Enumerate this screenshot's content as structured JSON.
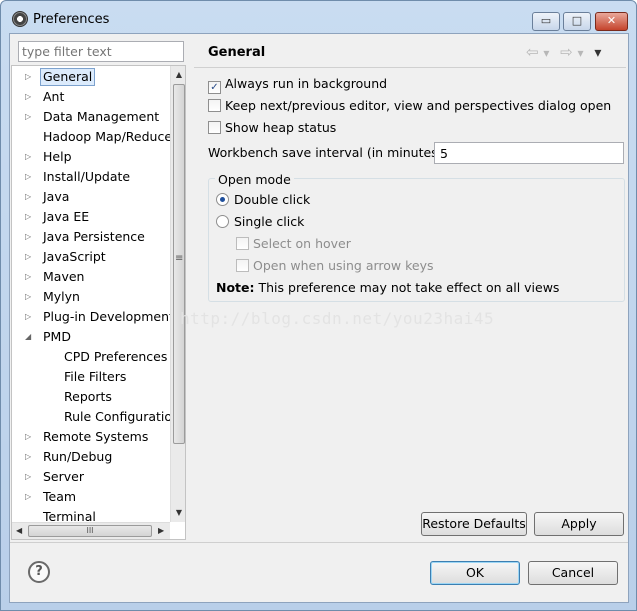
{
  "window": {
    "title": "Preferences",
    "min_glyph": "▭",
    "max_glyph": "□",
    "close_glyph": "✕"
  },
  "filter": {
    "placeholder": "type filter text"
  },
  "tree": {
    "items": [
      {
        "label": "General",
        "level": 0,
        "expander": "collapsed",
        "selected": true
      },
      {
        "label": "Ant",
        "level": 0,
        "expander": "collapsed"
      },
      {
        "label": "Data Management",
        "level": 0,
        "expander": "collapsed"
      },
      {
        "label": "Hadoop Map/Reduce",
        "level": 0,
        "expander": "none"
      },
      {
        "label": "Help",
        "level": 0,
        "expander": "collapsed"
      },
      {
        "label": "Install/Update",
        "level": 0,
        "expander": "collapsed"
      },
      {
        "label": "Java",
        "level": 0,
        "expander": "collapsed"
      },
      {
        "label": "Java EE",
        "level": 0,
        "expander": "collapsed"
      },
      {
        "label": "Java Persistence",
        "level": 0,
        "expander": "collapsed"
      },
      {
        "label": "JavaScript",
        "level": 0,
        "expander": "collapsed"
      },
      {
        "label": "Maven",
        "level": 0,
        "expander": "collapsed"
      },
      {
        "label": "Mylyn",
        "level": 0,
        "expander": "collapsed"
      },
      {
        "label": "Plug-in Development",
        "level": 0,
        "expander": "collapsed"
      },
      {
        "label": "PMD",
        "level": 0,
        "expander": "expanded"
      },
      {
        "label": "CPD Preferences",
        "level": 1,
        "expander": "none"
      },
      {
        "label": "File Filters",
        "level": 1,
        "expander": "none"
      },
      {
        "label": "Reports",
        "level": 1,
        "expander": "none"
      },
      {
        "label": "Rule Configuration",
        "level": 1,
        "expander": "none"
      },
      {
        "label": "Remote Systems",
        "level": 0,
        "expander": "collapsed"
      },
      {
        "label": "Run/Debug",
        "level": 0,
        "expander": "collapsed"
      },
      {
        "label": "Server",
        "level": 0,
        "expander": "collapsed"
      },
      {
        "label": "Team",
        "level": 0,
        "expander": "collapsed"
      },
      {
        "label": "Terminal",
        "level": 0,
        "expander": "none"
      }
    ],
    "scroll_up": "▲",
    "scroll_down": "▼",
    "scroll_left": "◀",
    "scroll_right": "▶",
    "vthumb_grip": "≡",
    "hthumb_grip": "III"
  },
  "general": {
    "title": "General",
    "nav_back": "⇦",
    "nav_back_menu": "▾",
    "nav_forward": "⇨",
    "nav_forward_menu": "▾",
    "view_menu": "▾",
    "always_run_bg": {
      "label": "Always run in background",
      "checked": true
    },
    "keep_dialog_open": {
      "label": "Keep next/previous editor, view and perspectives dialog open",
      "checked": false
    },
    "show_heap": {
      "label": "Show heap status",
      "checked": false
    },
    "interval": {
      "label": "Workbench save interval (in minutes):",
      "value": "5"
    },
    "open_mode": {
      "title": "Open mode",
      "double_click": {
        "label": "Double click",
        "selected": true
      },
      "single_click": {
        "label": "Single click",
        "selected": false
      },
      "select_on_hover": {
        "label": "Select on hover",
        "checked": false
      },
      "open_arrow_keys": {
        "label": "Open when using arrow keys",
        "checked": false
      },
      "note_bold": "Note:",
      "note_text": "This preference may not take effect on all views"
    },
    "restore_defaults": "Restore Defaults",
    "apply": "Apply"
  },
  "footer": {
    "ok": "OK",
    "cancel": "Cancel",
    "help_glyph": "?"
  },
  "watermark": "http://blog.csdn.net/you23hai45",
  "check_glyph": "✓"
}
